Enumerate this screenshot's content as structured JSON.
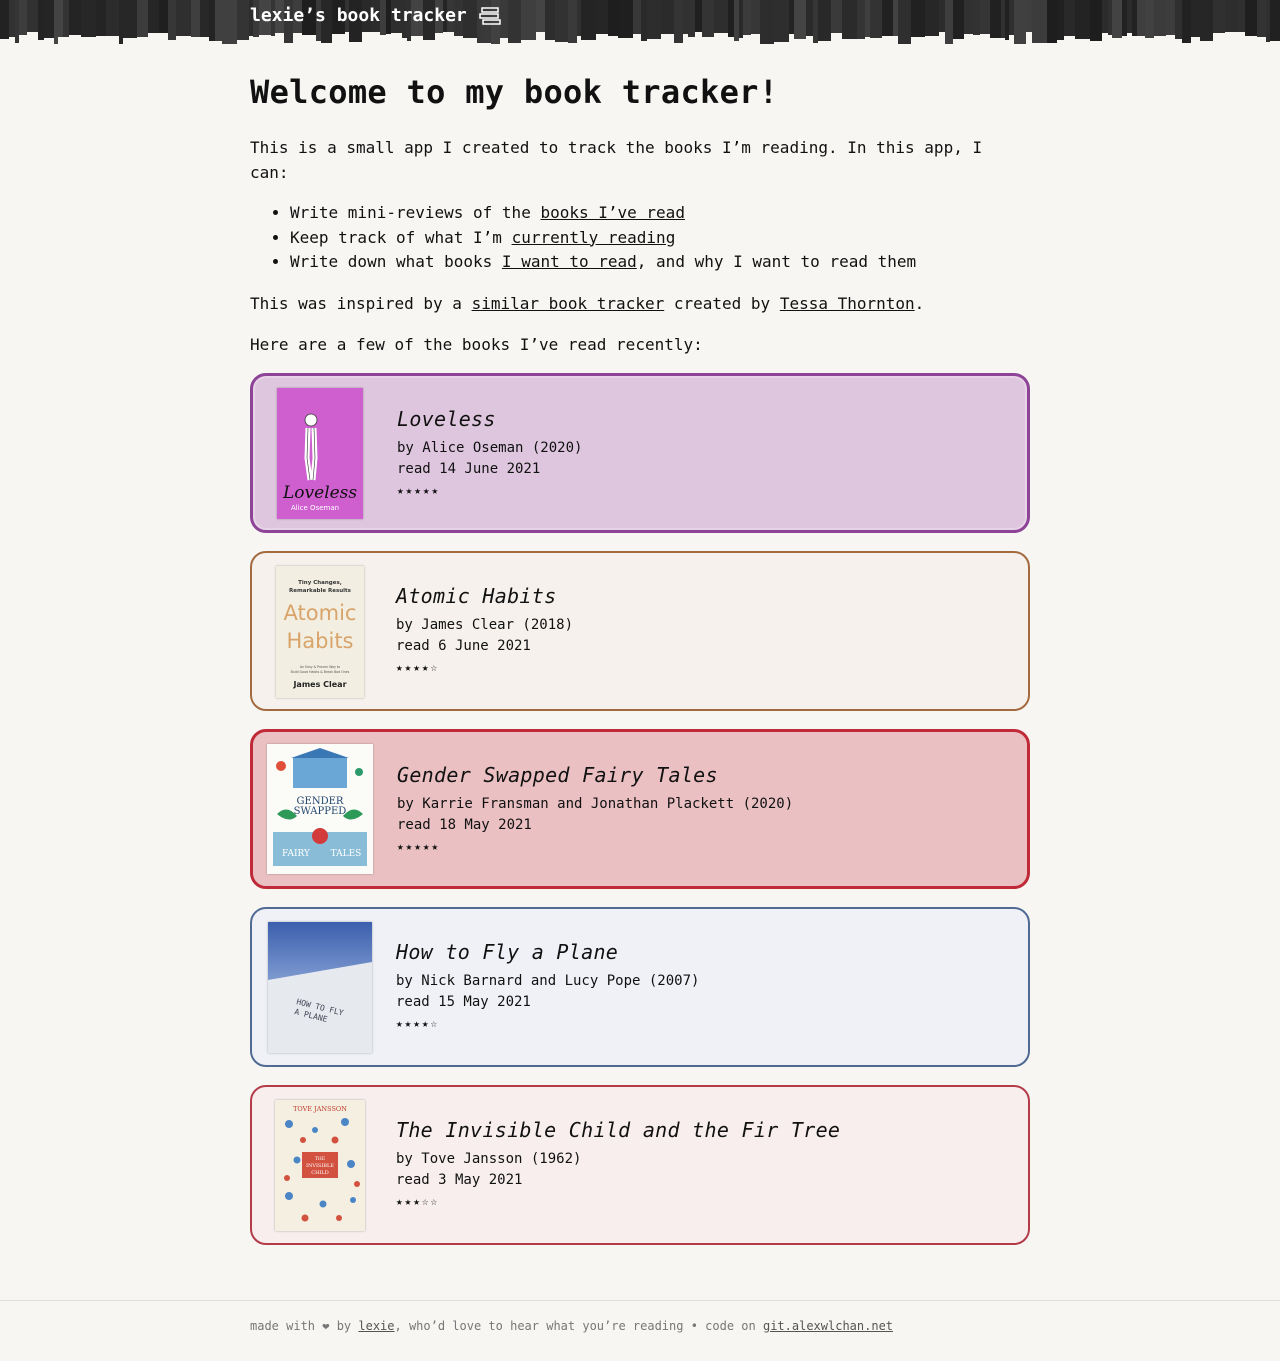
{
  "header": {
    "site_title": "lexie’s book tracker",
    "icon": "books-icon"
  },
  "intro": {
    "heading": "Welcome to my book tracker!",
    "paragraph": "This is a small app I created to track the books I’m reading. In this app, I can:",
    "list": [
      {
        "before": "Write mini-reviews of the ",
        "link": "books I’ve read",
        "after": ""
      },
      {
        "before": "Keep track of what I’m ",
        "link": "currently reading",
        "after": ""
      },
      {
        "before": "Write down what books ",
        "link": "I want to read",
        "after": ", and why I want to read them"
      }
    ],
    "inspired_before": "This was inspired by a ",
    "inspired_link1": "similar book tracker",
    "inspired_middle": " created by ",
    "inspired_link2": "Tessa Thornton",
    "inspired_after": ".",
    "recent_label": "Here are a few of the books I’ve read recently:"
  },
  "books": [
    {
      "title": "Loveless",
      "author_line": "by Alice Oseman (2020)",
      "read_line": "read 14 June 2021",
      "stars": "★★★★★",
      "rating": 5,
      "cover_text": "Loveless",
      "cover_author": "Alice Oseman"
    },
    {
      "title": "Atomic Habits",
      "author_line": "by James Clear (2018)",
      "read_line": "read 6 June 2021",
      "stars": "★★★★☆",
      "rating": 4,
      "cover_tagline": "Tiny Changes, Remarkable Results",
      "cover_text1": "Atomic",
      "cover_text2": "Habits",
      "cover_sub": "An Easy & Proven Way to Build Good Habits & Break Bad Ones",
      "cover_author": "James Clear"
    },
    {
      "title": "Gender Swapped Fairy Tales",
      "author_line": "by Karrie Fransman and Jonathan Plackett (2020)",
      "read_line": "read 18 May 2021",
      "stars": "★★★★★",
      "rating": 5,
      "cover_text1": "GENDER",
      "cover_text2": "SWAPPED",
      "cover_text3": "FAIRY",
      "cover_text4": "TALES"
    },
    {
      "title": "How to Fly a Plane",
      "author_line": "by Nick Barnard and Lucy Pope (2007)",
      "read_line": "read 15 May 2021",
      "stars": "★★★★☆",
      "rating": 4,
      "cover_text1": "HOW TO FLY",
      "cover_text2": "A PLANE"
    },
    {
      "title": "The Invisible Child and the Fir Tree",
      "author_line": "by Tove Jansson (1962)",
      "read_line": "read 3 May 2021",
      "stars": "★★★☆☆",
      "rating": 3,
      "cover_author": "TOVE JANSSON",
      "cover_text1": "THE",
      "cover_text2": "INVISIBLE",
      "cover_text3": "CHILD"
    }
  ],
  "footer": {
    "before": "made with ❤ by ",
    "link1": "lexie",
    "middle": ", who’d love to hear what you’re reading • code on ",
    "link2": "git.alexwlchan.net"
  },
  "colors": {
    "header_bg": "#2b2b2b",
    "card1_bg": "#dfc6df",
    "card1_border": "#8e4496",
    "card2_bg": "#f6f1ec",
    "card2_border": "#a46a3f",
    "card3_bg": "#eac0c2",
    "card3_border": "#c02a38",
    "card4_bg": "#eff1f7",
    "card4_border": "#4f6b94",
    "card5_bg": "#f8eeee",
    "card5_border": "#b33c48"
  }
}
